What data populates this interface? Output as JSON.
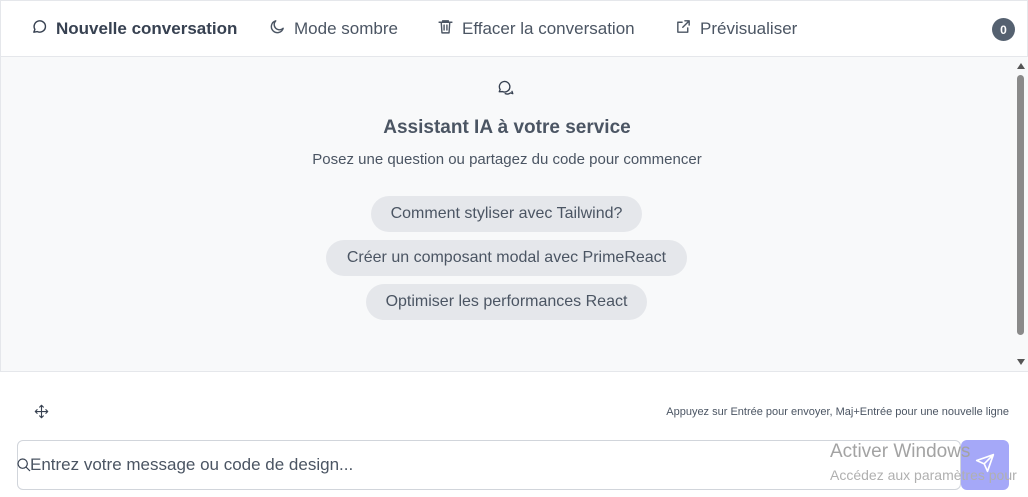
{
  "toolbar": {
    "new_conversation": {
      "label": "Nouvelle conversation",
      "icon": "chat-bubble-icon"
    },
    "dark_mode": {
      "label": "Mode sombre",
      "icon": "moon-icon"
    },
    "clear_conversation": {
      "label": "Effacer la conversation",
      "icon": "trash-icon"
    },
    "preview": {
      "label": "Prévisualiser",
      "icon": "external-link-icon"
    },
    "badge_count": "0"
  },
  "welcome": {
    "icon": "chat-bubbles-icon",
    "title": "Assistant IA à votre service",
    "subtitle": "Posez une question ou partagez du code pour commencer",
    "suggestions": [
      "Comment styliser avec Tailwind?",
      "Créer un composant modal avec PrimeReact",
      "Optimiser les performances React"
    ]
  },
  "composer": {
    "move_icon": "move-icon",
    "hint": "Appuyez sur Entrée pour envoyer, Maj+Entrée pour une nouvelle ligne",
    "placeholder": "Entrez votre message ou code de design...",
    "send_icon": "send-icon",
    "accent_color": "#a5a8f8"
  },
  "os_watermark": {
    "title": "Activer Windows",
    "subtitle": "Accédez aux paramètres pour"
  }
}
